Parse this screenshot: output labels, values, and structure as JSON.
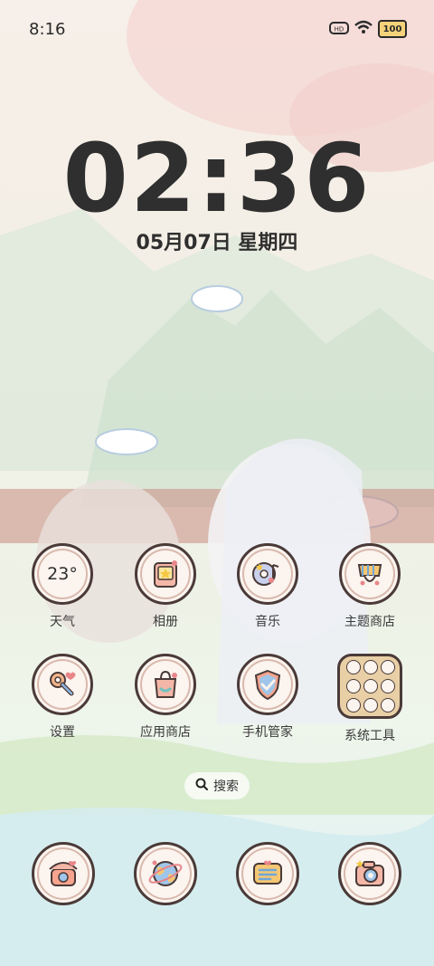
{
  "status_bar": {
    "time": "8:16",
    "battery_level": "100",
    "icons": [
      "hd-icon",
      "wifi-icon",
      "battery-icon"
    ]
  },
  "lockscreen": {
    "clock": "02:36",
    "date": "05月07日 星期四"
  },
  "apps": [
    {
      "label": "天气",
      "icon": "weather-icon",
      "value": "23°"
    },
    {
      "label": "相册",
      "icon": "gallery-icon"
    },
    {
      "label": "音乐",
      "icon": "music-icon"
    },
    {
      "label": "主题商店",
      "icon": "theme-store-icon"
    },
    {
      "label": "设置",
      "icon": "settings-icon"
    },
    {
      "label": "应用商店",
      "icon": "app-store-icon"
    },
    {
      "label": "手机管家",
      "icon": "phone-manager-icon"
    },
    {
      "label": "系统工具",
      "icon": "system-tools-icon"
    }
  ],
  "search": {
    "label": "搜索"
  },
  "dock": [
    {
      "icon": "phone-icon"
    },
    {
      "icon": "browser-icon"
    },
    {
      "icon": "messages-icon"
    },
    {
      "icon": "camera-icon"
    }
  ],
  "colors": {
    "accent_pink": "#e89a9a",
    "outline": "#4a3a38",
    "text": "#2f2f2f"
  }
}
